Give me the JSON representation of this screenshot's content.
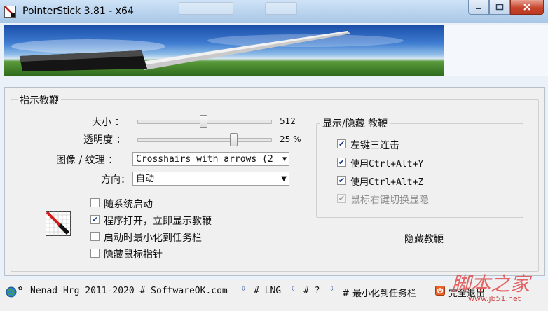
{
  "window": {
    "title": "PointerStick 3.81 - x64"
  },
  "main": {
    "group_title": "指示教鞭",
    "size": {
      "label": "大小 ：",
      "value": "512",
      "slider_fraction": 0.49
    },
    "opacity": {
      "label": "透明度 ：",
      "value": "25 %",
      "slider_fraction": 0.72
    },
    "image_texture": {
      "label": "图像 / 纹理 ：",
      "value": "Crosshairs with arrows (2"
    },
    "direction": {
      "label": "方向：",
      "value": "自动"
    },
    "options": [
      {
        "label": "随系统启动",
        "checked": false
      },
      {
        "label": "程序打开，立即显示教鞭",
        "checked": true
      },
      {
        "label": "启动时最小化到任务栏",
        "checked": false
      },
      {
        "label": "隐藏鼠标指针",
        "checked": false
      }
    ],
    "show_hide": {
      "title": "显示/隐藏 教鞭",
      "items": [
        {
          "label": "左键三连击",
          "checked": true,
          "enabled": true
        },
        {
          "label": "使用Ctrl+Alt+Y",
          "checked": true,
          "enabled": true
        },
        {
          "label": "使用Ctrl+Alt+Z",
          "checked": true,
          "enabled": true
        },
        {
          "label": "鼠标右键切换显隐",
          "checked": true,
          "enabled": false
        }
      ]
    },
    "hide_button": "隐藏教鞭"
  },
  "bottom": {
    "copyright": "Nenad Hrg 2011-2020 # SoftwareOK.com",
    "lng": "# LNG",
    "help": "# ?",
    "minimize": "# 最小化到任务栏",
    "exit": "完全退出"
  },
  "watermark": {
    "main": "脚本之家",
    "sub": "www.jb51.net"
  },
  "colors": {
    "titlebar": "#b9d3ee",
    "close": "#c8452d",
    "check": "#1a3a8a",
    "watermark": "#e24a4a"
  }
}
